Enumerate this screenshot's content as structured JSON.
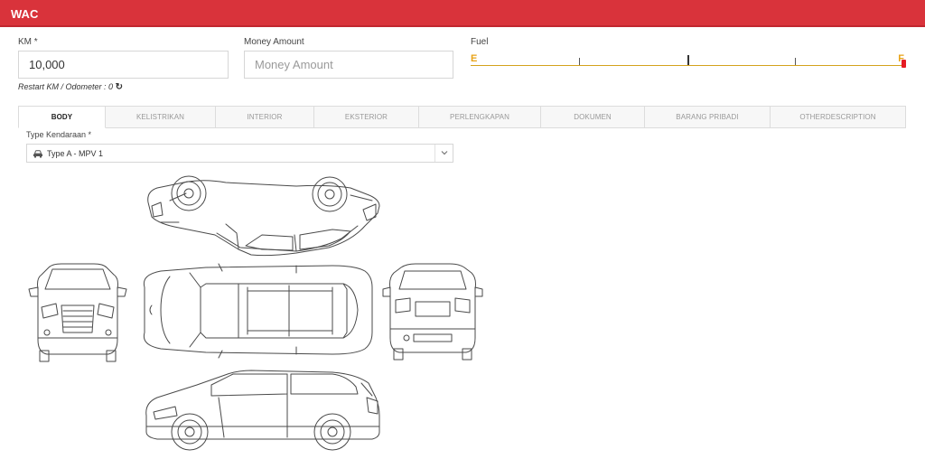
{
  "header": {
    "title": "WAC"
  },
  "km": {
    "label": "KM *",
    "value": "10,000"
  },
  "money": {
    "label": "Money Amount",
    "placeholder": "Money Amount"
  },
  "fuel": {
    "label": "Fuel",
    "empty_mark": "E",
    "full_mark": "F",
    "level": 1.0
  },
  "restart": {
    "text": "Restart KM / Odometer : 0"
  },
  "tabs": [
    {
      "label": "BODY",
      "active": true
    },
    {
      "label": "KELISTRIKAN"
    },
    {
      "label": "INTERIOR"
    },
    {
      "label": "EKSTERIOR"
    },
    {
      "label": "PERLENGKAPAN"
    },
    {
      "label": "DOKUMEN"
    },
    {
      "label": "BARANG PRIBADI"
    },
    {
      "label": "OTHERDESCRIPTION"
    }
  ],
  "vehicle_type": {
    "label": "Type Kendaraan *",
    "selected": "Type A - MPV 1",
    "icon": "car-icon"
  },
  "colors": {
    "header": "#d9333b",
    "fuel_mark": "#e8a317",
    "fuel_handle": "#e51c24"
  }
}
